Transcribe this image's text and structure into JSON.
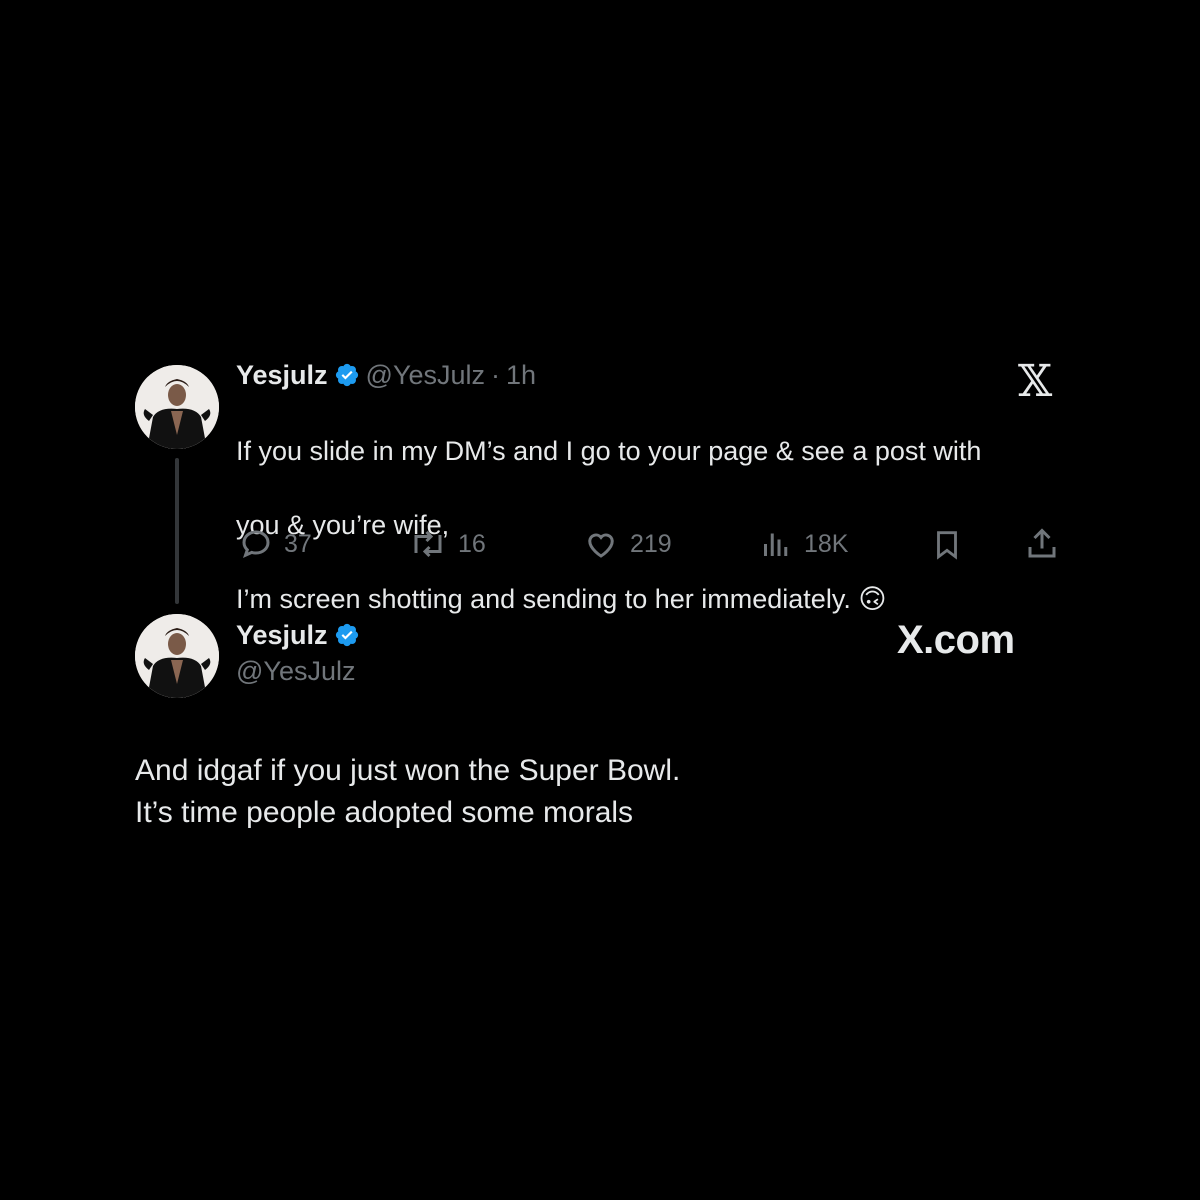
{
  "tweet1": {
    "name": "Yesjulz",
    "handle": "@YesJulz",
    "separator": "·",
    "time": "1h",
    "text_line1": "If you slide in my DM’s and I go to your page & see a post with",
    "text_line2": "you & you’re wife,",
    "text_line3": "I’m screen shotting and sending to her immediately. 🙃",
    "actions": {
      "replies": "37",
      "reposts": "16",
      "likes": "219",
      "views": "18K"
    }
  },
  "tweet2": {
    "name": "Yesjulz",
    "handle": "@YesJulz",
    "text_line1": "And idgaf if you just won the Super Bowl.",
    "text_line2": "It’s time people adopted some morals"
  },
  "branding": {
    "x_logo": "𝕏",
    "x_com": "X.com"
  },
  "colors": {
    "background": "#000000",
    "text": "#e7e9ea",
    "muted": "#71767b",
    "verified": "#1d9bf0"
  }
}
